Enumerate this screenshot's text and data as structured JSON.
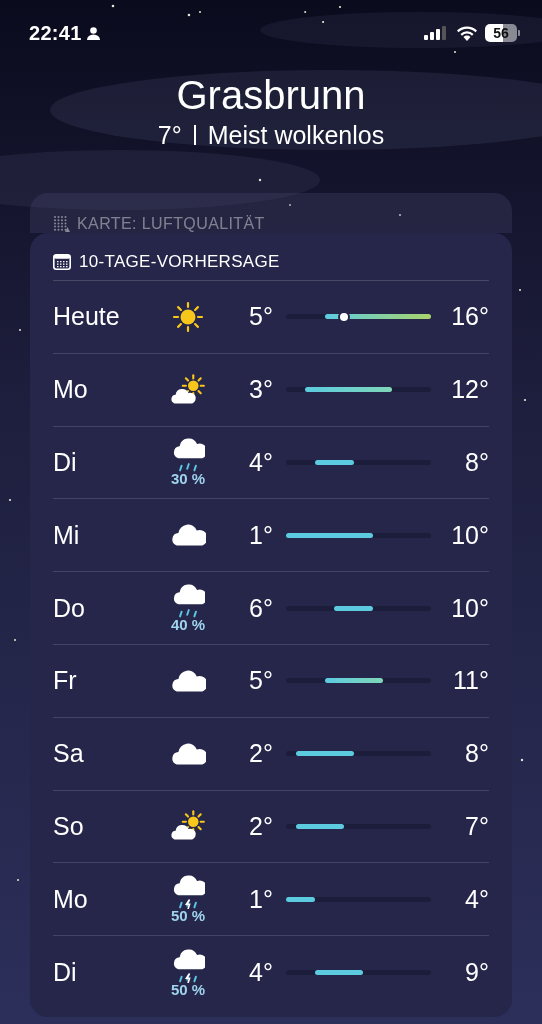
{
  "status_bar": {
    "time": "22:41",
    "battery": "56"
  },
  "location": {
    "name": "Grasbrunn",
    "temperature": "7°",
    "condition": "Meist wolkenlos"
  },
  "air_quality_card": {
    "title": "KARTE: LUFTQUALITÄT"
  },
  "forecast": {
    "title": "10-TAGE-VORHERSAGE",
    "days": [
      {
        "day": "Heute",
        "kind": "sun",
        "low": "5°",
        "high": "16°",
        "now_marker": true
      },
      {
        "day": "Mo",
        "kind": "partly_sunny",
        "low": "3°",
        "high": "12°",
        "now_marker": false
      },
      {
        "day": "Di",
        "kind": "rain",
        "precipitation": "30 %",
        "low": "4°",
        "high": "8°",
        "now_marker": false
      },
      {
        "day": "Mi",
        "kind": "cloud",
        "low": "1°",
        "high": "10°",
        "now_marker": false
      },
      {
        "day": "Do",
        "kind": "rain",
        "precipitation": "40 %",
        "low": "6°",
        "high": "10°",
        "now_marker": false
      },
      {
        "day": "Fr",
        "kind": "cloud",
        "low": "5°",
        "high": "11°",
        "now_marker": false
      },
      {
        "day": "Sa",
        "kind": "cloud",
        "low": "2°",
        "high": "8°",
        "now_marker": false
      },
      {
        "day": "So",
        "kind": "partly_sunny",
        "low": "2°",
        "high": "7°",
        "now_marker": false
      },
      {
        "day": "Mo",
        "kind": "thunder_rain",
        "precipitation": "50 %",
        "low": "1°",
        "high": "4°",
        "now_marker": false
      },
      {
        "day": "Di",
        "kind": "thunder_rain",
        "precipitation": "50 %",
        "low": "4°",
        "high": "9°",
        "now_marker": false
      }
    ]
  }
}
